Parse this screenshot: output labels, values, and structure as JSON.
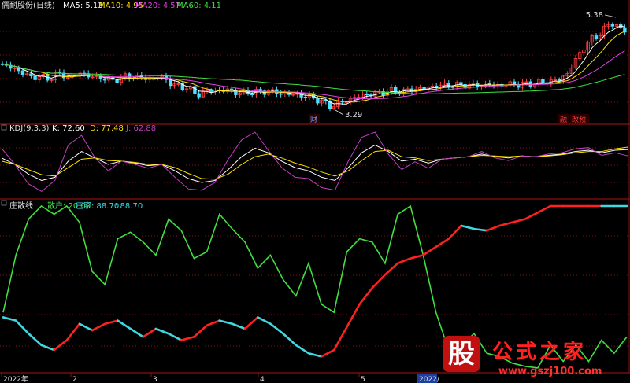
{
  "colors": {
    "bg": "#000000",
    "grid": "#8a1010",
    "up": "#ff4040",
    "down": "#4fdfff",
    "ma5": "#ffffff",
    "ma10": "#ffe000",
    "ma20": "#e040e0",
    "ma60": "#40e040",
    "kdj_k": "#ffffff",
    "kdj_d": "#ffe000",
    "kdj_j": "#c040c0",
    "retail": "#40e040",
    "dealer_up": "#ff2020",
    "dealer_down": "#40d8e0"
  },
  "main_panel": {
    "title": "儒耐股份(日线)",
    "ma_labels": [
      {
        "name": "MA5: 5.13",
        "color": "#ffffff"
      },
      {
        "name": "MA10: 4.95",
        "color": "#ffe000"
      },
      {
        "name": "MA20: 4.57",
        "color": "#e040e0"
      },
      {
        "name": "MA60: 4.11",
        "color": "#40e040"
      }
    ],
    "high_label": "5.38",
    "low_label": "3.29",
    "event_markers": [
      "财",
      "融",
      "改预"
    ]
  },
  "kdj_panel": {
    "name": "KDJ(9,3,3)",
    "k_label": "K: 72.60",
    "d_label": "D: 77.48",
    "j_label": "J: 62.88"
  },
  "dealer_panel": {
    "name": "庄散线",
    "retail_label": "散户: 20.00",
    "dealer_label": "庄家: 88.70",
    "extra_label": ": 88.70"
  },
  "x_axis": {
    "ticks": [
      "2022年",
      "2",
      "3",
      "4",
      "5",
      "2022/"
    ]
  },
  "watermark": {
    "glyph": "股",
    "text": "公式之家",
    "url": "www.gszj100.com"
  },
  "chart_data": [
    {
      "type": "candlestick",
      "title": "儒耐股份(日线)",
      "x": "trading days, Jan–Jun 2022",
      "ylim": [
        3.0,
        5.6
      ],
      "close_path": [
        [
          0,
          4.34
        ],
        [
          10,
          4.28
        ],
        [
          20,
          4.22
        ],
        [
          30,
          4.12
        ],
        [
          40,
          4.02
        ],
        [
          50,
          4.06
        ],
        [
          60,
          3.98
        ],
        [
          70,
          4.1
        ],
        [
          80,
          4.08
        ],
        [
          90,
          4.0
        ],
        [
          100,
          4.14
        ],
        [
          110,
          4.08
        ],
        [
          120,
          4.02
        ],
        [
          130,
          4.04
        ],
        [
          140,
          3.94
        ],
        [
          150,
          4.0
        ],
        [
          160,
          4.05
        ],
        [
          170,
          4.04
        ],
        [
          180,
          4.02
        ],
        [
          190,
          3.98
        ],
        [
          200,
          4.03
        ],
        [
          210,
          4.0
        ],
        [
          220,
          3.84
        ],
        [
          230,
          3.82
        ],
        [
          240,
          3.78
        ],
        [
          250,
          3.62
        ],
        [
          260,
          3.7
        ],
        [
          270,
          3.74
        ],
        [
          280,
          3.72
        ],
        [
          290,
          3.74
        ],
        [
          300,
          3.68
        ],
        [
          310,
          3.66
        ],
        [
          320,
          3.7
        ],
        [
          330,
          3.68
        ],
        [
          340,
          3.72
        ],
        [
          350,
          3.68
        ],
        [
          360,
          3.66
        ],
        [
          370,
          3.64
        ],
        [
          380,
          3.62
        ],
        [
          390,
          3.58
        ],
        [
          400,
          3.54
        ],
        [
          410,
          3.46
        ],
        [
          420,
          3.36
        ],
        [
          430,
          3.42
        ],
        [
          440,
          3.5
        ],
        [
          450,
          3.56
        ],
        [
          460,
          3.62
        ],
        [
          470,
          3.64
        ],
        [
          480,
          3.66
        ],
        [
          490,
          3.7
        ],
        [
          500,
          3.72
        ],
        [
          510,
          3.7
        ],
        [
          520,
          3.74
        ],
        [
          530,
          3.76
        ],
        [
          540,
          3.78
        ],
        [
          550,
          3.82
        ],
        [
          560,
          3.84
        ],
        [
          570,
          3.86
        ],
        [
          580,
          3.84
        ],
        [
          590,
          3.86
        ],
        [
          600,
          3.84
        ],
        [
          610,
          3.86
        ],
        [
          620,
          3.86
        ],
        [
          630,
          3.84
        ],
        [
          640,
          3.86
        ],
        [
          650,
          3.88
        ],
        [
          660,
          3.86
        ],
        [
          670,
          3.88
        ],
        [
          680,
          3.9
        ],
        [
          690,
          3.92
        ],
        [
          700,
          3.94
        ],
        [
          710,
          3.98
        ],
        [
          720,
          4.1
        ],
        [
          730,
          4.4
        ],
        [
          740,
          4.7
        ],
        [
          750,
          4.9
        ],
        [
          760,
          5.0
        ],
        [
          770,
          5.2
        ],
        [
          780,
          5.3
        ],
        [
          790,
          5.1
        ]
      ],
      "ma5_label": "MA5: 5.13",
      "ma10_label": "MA10: 4.95",
      "ma20_label": "MA20: 4.57",
      "ma60_label": "MA60: 4.11",
      "high": 5.38,
      "low": 3.29
    },
    {
      "type": "line",
      "title": "KDJ(9,3,3)",
      "ylim": [
        0,
        100
      ],
      "series": [
        {
          "name": "K",
          "values": [
            60,
            50,
            35,
            25,
            30,
            55,
            70,
            60,
            50,
            55,
            52,
            48,
            50,
            40,
            28,
            22,
            25,
            42,
            62,
            75,
            68,
            55,
            45,
            40,
            30,
            25,
            45,
            68,
            80,
            70,
            55,
            58,
            52,
            58,
            60,
            62,
            66,
            62,
            60,
            63,
            62,
            64,
            66,
            70,
            72,
            68,
            72,
            73
          ]
        },
        {
          "name": "D",
          "values": [
            55,
            50,
            42,
            34,
            32,
            45,
            58,
            60,
            56,
            55,
            53,
            50,
            50,
            45,
            36,
            28,
            27,
            35,
            50,
            62,
            66,
            60,
            52,
            46,
            38,
            32,
            40,
            56,
            70,
            72,
            62,
            60,
            56,
            58,
            60,
            62,
            64,
            63,
            62,
            63,
            62,
            63,
            65,
            68,
            70,
            70,
            74,
            77
          ]
        },
        {
          "name": "J",
          "values": [
            75,
            50,
            20,
            8,
            25,
            80,
            95,
            60,
            40,
            55,
            50,
            44,
            50,
            30,
            12,
            10,
            22,
            58,
            88,
            100,
            72,
            45,
            30,
            28,
            14,
            10,
            55,
            92,
            100,
            66,
            42,
            54,
            44,
            58,
            60,
            62,
            70,
            60,
            56,
            63,
            62,
            66,
            68,
            74,
            76,
            64,
            68,
            63
          ]
        }
      ]
    },
    {
      "type": "line",
      "title": "庄散线",
      "ylim": [
        0,
        100
      ],
      "series": [
        {
          "name": "散户",
          "values": [
            35,
            70,
            92,
            100,
            95,
            100,
            90,
            60,
            52,
            80,
            84,
            78,
            70,
            92,
            85,
            68,
            72,
            95,
            86,
            78,
            62,
            70,
            55,
            45,
            65,
            40,
            35,
            72,
            80,
            78,
            65,
            95,
            100,
            70,
            35,
            12,
            15,
            22,
            10,
            8,
            4,
            2,
            1,
            15,
            5,
            15,
            5,
            18,
            10,
            20
          ]
        },
        {
          "name": "庄家",
          "values": [
            32,
            30,
            22,
            15,
            12,
            18,
            28,
            24,
            28,
            30,
            25,
            20,
            25,
            22,
            18,
            20,
            27,
            30,
            28,
            25,
            32,
            28,
            22,
            15,
            10,
            8,
            12,
            26,
            40,
            50,
            58,
            65,
            68,
            70,
            75,
            80,
            88,
            86,
            85,
            88,
            90,
            92,
            96,
            100,
            105,
            110,
            115,
            118,
            116,
            114
          ]
        }
      ]
    }
  ]
}
